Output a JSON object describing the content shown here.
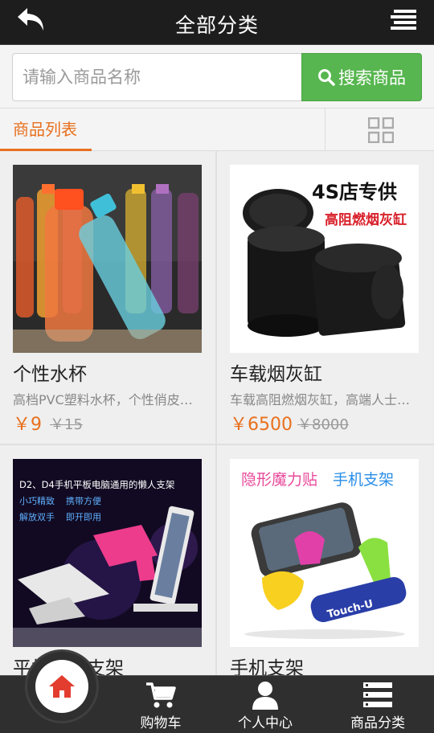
{
  "header": {
    "title": "全部分类"
  },
  "search": {
    "placeholder": "请输入商品名称",
    "button_label": "搜索商品"
  },
  "tabs": {
    "list_label": "商品列表"
  },
  "products": [
    {
      "name": "个性水杯",
      "desc": "高档PVC塑料水杯，个性俏皮的造型设计",
      "price": "￥9",
      "old_price": "￥15"
    },
    {
      "name": "车载烟灰缸",
      "desc": "车载高阻燃烟灰缸，高端人士必备精品",
      "price": "￥6500",
      "old_price": "￥8000",
      "image_text": {
        "line1": "4S店专供",
        "line2": "高阻燃烟灰缸"
      }
    },
    {
      "name": "平板电脑支架",
      "desc": "",
      "image_text": {
        "line1": "D2、D4手机平板电脑通用的懒人支架",
        "tags": [
          "小巧精致",
          "携带方便",
          "解放双手",
          "即开即用"
        ]
      }
    },
    {
      "name": "手机支架",
      "desc": "",
      "image_text": {
        "line1": "隐形魔力贴",
        "line1b": "手机支架",
        "brand": "Touch-U"
      }
    }
  ],
  "bottom_nav": {
    "cart": "购物车",
    "profile": "个人中心",
    "categories": "商品分类"
  },
  "colors": {
    "accent": "#e8701e",
    "search_button": "#57b64f",
    "header_bg": "#1d1d1d",
    "nav_bg": "#2f2f2f",
    "home_icon": "#e23d2f"
  }
}
